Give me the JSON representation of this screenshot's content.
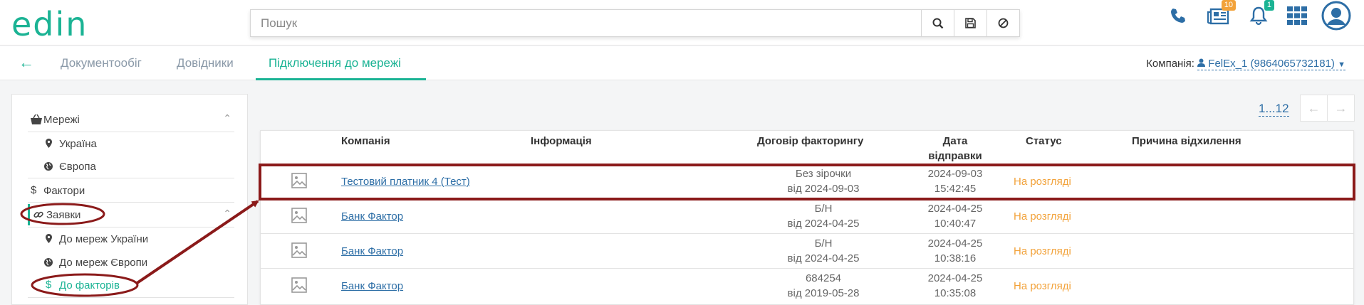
{
  "header": {
    "logo": "edin",
    "search_placeholder": "Пошук",
    "notifications_badge": "1",
    "documents_badge": "10"
  },
  "nav": {
    "tabs": [
      "Документообіг",
      "Довідники",
      "Підключення до мережі"
    ],
    "company_label": "Компанія:",
    "company_value": "FelEx_1 (9864065732181)"
  },
  "sidebar": {
    "networks": "Мережі",
    "ukraine": "Україна",
    "europe": "Європа",
    "factors": "Фактори",
    "requests": "Заявки",
    "to_ukraine": "До мереж України",
    "to_europe": "До мереж Європи",
    "to_factors": "До факторів"
  },
  "pager": {
    "label": "1...12"
  },
  "table": {
    "headers": {
      "company": "Компанія",
      "info": "Інформація",
      "contract": "Договір факторингу",
      "date_1": "Дата",
      "date_2": "відправки",
      "status": "Статус",
      "reason": "Причина відхилення"
    },
    "rows": [
      {
        "company": "Тестовий платник 4 (Тест)",
        "contract_1": "Без зірочки",
        "contract_2": "від 2024-09-03",
        "date": "2024-09-03",
        "time": "15:42:45",
        "status": "На розгляді"
      },
      {
        "company": "Банк Фактор",
        "contract_1": "Б/Н",
        "contract_2": "від 2024-04-25",
        "date": "2024-04-25",
        "time": "10:40:47",
        "status": "На розгляді"
      },
      {
        "company": "Банк Фактор",
        "contract_1": "Б/Н",
        "contract_2": "від 2024-04-25",
        "date": "2024-04-25",
        "time": "10:38:16",
        "status": "На розгляді"
      },
      {
        "company": "Банк Фактор",
        "contract_1": "684254",
        "contract_2": "від 2019-05-28",
        "date": "2024-04-25",
        "time": "10:35:08",
        "status": "На розгляді"
      }
    ]
  },
  "colors": {
    "accent": "#1bb394",
    "link": "#2d6ea6",
    "status": "#f2a23a",
    "annotation": "#8b1a1a"
  }
}
